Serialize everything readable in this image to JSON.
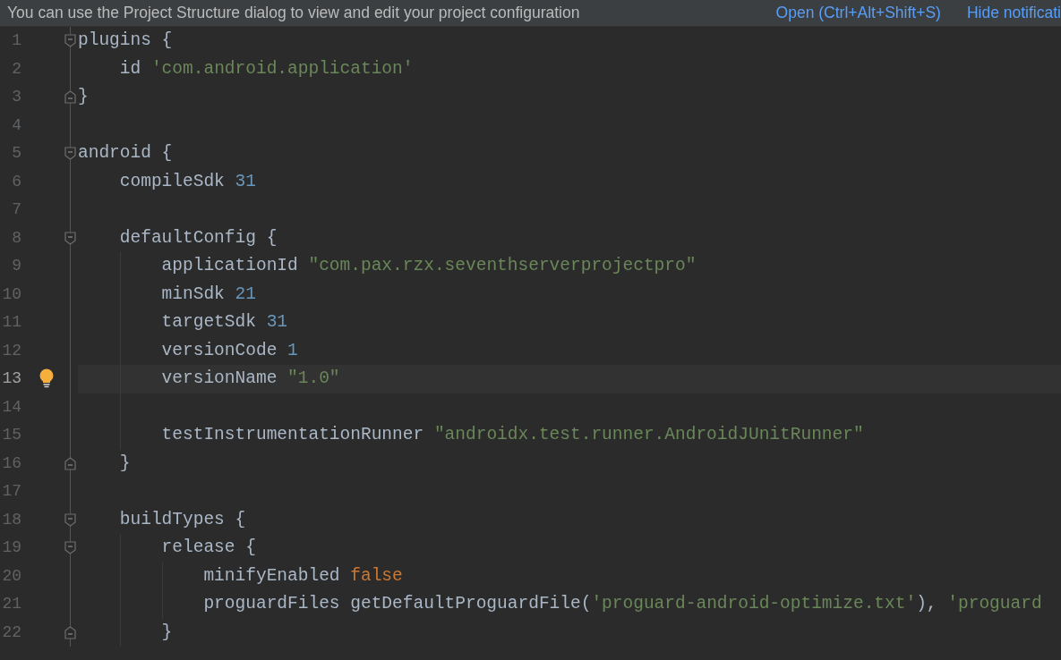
{
  "notification": {
    "message": "You can use the Project Structure dialog to view and edit your project configuration",
    "links": [
      "Open (Ctrl+Alt+Shift+S)",
      "Hide notificati"
    ]
  },
  "editor": {
    "lines": [
      {
        "number": "1",
        "fold_start": true,
        "fold_end": false,
        "current": false,
        "bulb": false,
        "tokens": [
          {
            "kind": "plain",
            "text": "plugins {"
          }
        ]
      },
      {
        "number": "2",
        "fold_start": false,
        "fold_end": false,
        "current": false,
        "bulb": false,
        "tokens": [
          {
            "kind": "plain",
            "text": "    id "
          },
          {
            "kind": "string",
            "text": "'com.android.application'"
          }
        ]
      },
      {
        "number": "3",
        "fold_start": false,
        "fold_end": true,
        "current": false,
        "bulb": false,
        "tokens": [
          {
            "kind": "plain",
            "text": "}"
          }
        ]
      },
      {
        "number": "4",
        "fold_start": false,
        "fold_end": false,
        "current": false,
        "bulb": false
      },
      {
        "number": "5",
        "fold_start": true,
        "fold_end": false,
        "current": false,
        "bulb": false,
        "tokens": [
          {
            "kind": "plain",
            "text": "android {"
          }
        ]
      },
      {
        "number": "6",
        "fold_start": false,
        "fold_end": false,
        "current": false,
        "bulb": false,
        "tokens": [
          {
            "kind": "plain",
            "text": "    compileSdk "
          },
          {
            "kind": "number",
            "text": "31"
          }
        ]
      },
      {
        "number": "7",
        "fold_start": false,
        "fold_end": false,
        "current": false,
        "bulb": false
      },
      {
        "number": "8",
        "fold_start": true,
        "fold_end": false,
        "current": false,
        "bulb": false,
        "tokens": [
          {
            "kind": "plain",
            "text": "    defaultConfig {"
          }
        ]
      },
      {
        "number": "9",
        "fold_start": false,
        "fold_end": false,
        "current": false,
        "bulb": false,
        "tokens": [
          {
            "kind": "plain",
            "text": "        applicationId "
          },
          {
            "kind": "string",
            "text": "\"com.pax.rzx.seventhserverprojectpro\""
          }
        ]
      },
      {
        "number": "10",
        "fold_start": false,
        "fold_end": false,
        "current": false,
        "bulb": false,
        "tokens": [
          {
            "kind": "plain",
            "text": "        minSdk "
          },
          {
            "kind": "number",
            "text": "21"
          }
        ]
      },
      {
        "number": "11",
        "fold_start": false,
        "fold_end": false,
        "current": false,
        "bulb": false,
        "tokens": [
          {
            "kind": "plain",
            "text": "        targetSdk "
          },
          {
            "kind": "number",
            "text": "31"
          }
        ]
      },
      {
        "number": "12",
        "fold_start": false,
        "fold_end": false,
        "current": false,
        "bulb": false,
        "tokens": [
          {
            "kind": "plain",
            "text": "        versionCode "
          },
          {
            "kind": "number",
            "text": "1"
          }
        ]
      },
      {
        "number": "13",
        "fold_start": false,
        "fold_end": false,
        "current": true,
        "bulb": true,
        "tokens": [
          {
            "kind": "plain",
            "text": "        versionName "
          },
          {
            "kind": "string",
            "text": "\"1.0\""
          }
        ]
      },
      {
        "number": "14",
        "fold_start": false,
        "fold_end": false,
        "current": false,
        "bulb": false
      },
      {
        "number": "15",
        "fold_start": false,
        "fold_end": false,
        "current": false,
        "bulb": false,
        "tokens": [
          {
            "kind": "plain",
            "text": "        testInstrumentationRunner "
          },
          {
            "kind": "string",
            "text": "\"androidx.test.runner.AndroidJUnitRunner\""
          }
        ]
      },
      {
        "number": "16",
        "fold_start": false,
        "fold_end": true,
        "current": false,
        "bulb": false,
        "tokens": [
          {
            "kind": "plain",
            "text": "    }"
          }
        ]
      },
      {
        "number": "17",
        "fold_start": false,
        "fold_end": false,
        "current": false,
        "bulb": false
      },
      {
        "number": "18",
        "fold_start": true,
        "fold_end": false,
        "current": false,
        "bulb": false,
        "tokens": [
          {
            "kind": "plain",
            "text": "    buildTypes {"
          }
        ]
      },
      {
        "number": "19",
        "fold_start": true,
        "fold_end": false,
        "current": false,
        "bulb": false,
        "tokens": [
          {
            "kind": "plain",
            "text": "        release {"
          }
        ]
      },
      {
        "number": "20",
        "fold_start": false,
        "fold_end": false,
        "current": false,
        "bulb": false,
        "tokens": [
          {
            "kind": "plain",
            "text": "            minifyEnabled "
          },
          {
            "kind": "keyword",
            "text": "false"
          }
        ]
      },
      {
        "number": "21",
        "fold_start": false,
        "fold_end": false,
        "current": false,
        "bulb": false,
        "tokens": [
          {
            "kind": "plain",
            "text": "            proguardFiles getDefaultProguardFile("
          },
          {
            "kind": "string",
            "text": "'proguard-android-optimize.txt'"
          },
          {
            "kind": "plain",
            "text": "), "
          },
          {
            "kind": "string",
            "text": "'proguard"
          }
        ]
      },
      {
        "number": "22",
        "fold_start": false,
        "fold_end": true,
        "current": false,
        "bulb": false,
        "tokens": [
          {
            "kind": "plain",
            "text": "        }"
          }
        ]
      }
    ]
  }
}
